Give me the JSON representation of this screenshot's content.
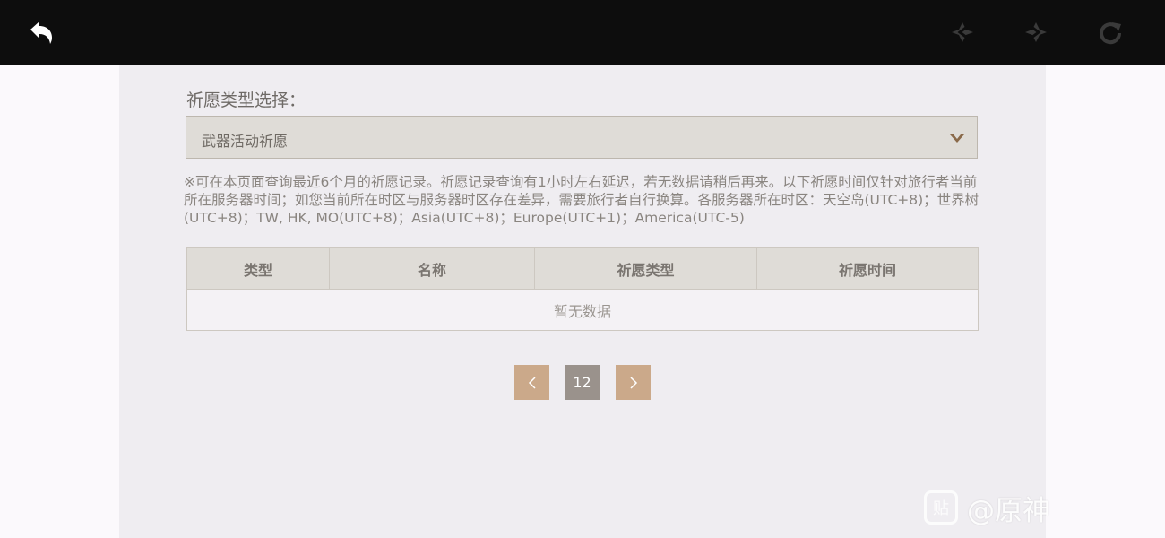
{
  "toolbar": {
    "back_icon": "back-arrow-icon",
    "prev_icon": "nav-back-icon",
    "next_icon": "nav-forward-icon",
    "reload_icon": "reload-icon"
  },
  "filter": {
    "label": "祈愿类型选择：",
    "selected": "武器活动祈愿"
  },
  "notice": "※可在本页面查询最近6个月的祈愿记录。祈愿记录查询有1小时左右延迟，若无数据请稍后再来。以下祈愿时间仅针对旅行者当前所在服务器时间；如您当前所在时区与服务器时区存在差异，需要旅行者自行换算。各服务器所在时区：天空岛(UTC+8)；世界树(UTC+8)；TW, HK, MO(UTC+8)；Asia(UTC+8)；Europe(UTC+1)；America(UTC-5)",
  "table": {
    "columns": [
      "类型",
      "名称",
      "祈愿类型",
      "祈愿时间"
    ],
    "empty_text": "暂无数据"
  },
  "pagination": {
    "current_page": "12"
  },
  "watermark": {
    "logo_text": "贴",
    "text": "@原神"
  },
  "colors": {
    "topbar": "#0d0d0d",
    "accent": "#cba98a",
    "page_active": "#9a928c"
  }
}
